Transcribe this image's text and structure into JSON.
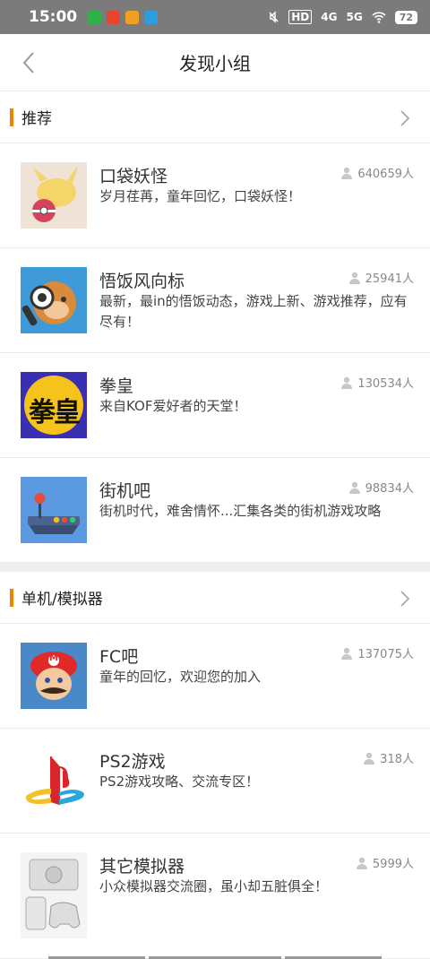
{
  "status_bar": {
    "time": "15:00",
    "battery": "72",
    "network1": "4G",
    "network2": "5G",
    "hd": "HD"
  },
  "header": {
    "title": "发现小组"
  },
  "sections": [
    {
      "title": "推荐",
      "items": [
        {
          "name": "口袋妖怪",
          "desc": "岁月荏苒，童年回忆，口袋妖怪！",
          "members": "640659人"
        },
        {
          "name": "悟饭风向标",
          "desc": "最新，最in的悟饭动态，游戏上新、游戏推荐，应有尽有！",
          "members": "25941人"
        },
        {
          "name": "拳皇",
          "desc": "来自KOF爱好者的天堂！",
          "members": "130534人",
          "thumb_text": "拳皇"
        },
        {
          "name": "街机吧",
          "desc": "街机时代，难舍情怀...汇集各类的街机游戏攻略",
          "members": "98834人"
        }
      ]
    },
    {
      "title": "单机/模拟器",
      "items": [
        {
          "name": "FC吧",
          "desc": "童年的回忆，欢迎您的加入",
          "members": "137075人",
          "thumb_text": "M"
        },
        {
          "name": "PS2游戏",
          "desc": "PS2游戏攻略、交流专区！",
          "members": "318人"
        },
        {
          "name": "其它模拟器",
          "desc": "小众模拟器交流圈，虽小却五脏俱全！",
          "members": "5999人"
        }
      ]
    }
  ],
  "colors": {
    "accent": "#f08300",
    "status_bar": "#7b7b7b"
  }
}
